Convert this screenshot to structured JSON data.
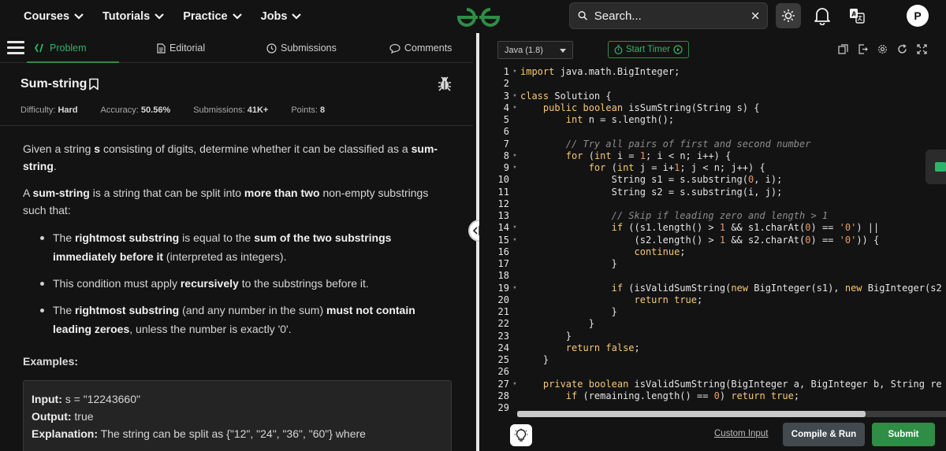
{
  "nav": {
    "items": [
      {
        "label": "Courses"
      },
      {
        "label": "Tutorials"
      },
      {
        "label": "Practice"
      },
      {
        "label": "Jobs"
      }
    ],
    "search_placeholder": "Search...",
    "avatar_letter": "P"
  },
  "tabs": [
    {
      "label": "Problem",
      "icon": "code-icon"
    },
    {
      "label": "Editorial",
      "icon": "document-icon"
    },
    {
      "label": "Submissions",
      "icon": "clock-icon"
    },
    {
      "label": "Comments",
      "icon": "chat-bubble-icon"
    }
  ],
  "problem": {
    "title": "Sum-string",
    "meta": [
      {
        "label": "Difficulty:",
        "value": "Hard"
      },
      {
        "label": "Accuracy:",
        "value": "50.56%"
      },
      {
        "label": "Submissions:",
        "value": "41K+"
      },
      {
        "label": "Points:",
        "value": "8"
      }
    ],
    "p1": {
      "a": "Given a string ",
      "b": "s",
      "c": " consisting of digits, determine whether it can be classified as a ",
      "d": "sum-string",
      "e": "."
    },
    "p2": {
      "a": "A ",
      "b": "sum-string",
      "c": " is a string that can be split into ",
      "d": "more than two",
      "e": " non-empty substrings such that:"
    },
    "bullet1": {
      "a": "The ",
      "b": "rightmost substring",
      "c": " is equal to the ",
      "d": "sum of the two substrings immediately before it",
      "e": " (interpreted as integers)."
    },
    "bullet2": {
      "a": "This condition must apply ",
      "b": "recursively",
      "c": " to the substrings before it."
    },
    "bullet3": {
      "a": "The ",
      "b": "rightmost substring",
      "c": " (and any number in the sum) ",
      "d": "must not contain leading zeroes",
      "e": ", unless the number is exactly '0'."
    },
    "examples_label": "Examples:",
    "example": {
      "input_label": "Input:",
      "input_value": "s = \"12243660\"",
      "output_label": "Output:",
      "output_value": "true",
      "explanation_label": "Explanation:",
      "explanation_value": "The string can be split as {\"12\", \"24\", \"36\", \"60\"} where"
    }
  },
  "editor": {
    "language": "Java (1.8)",
    "timer_label": "Start Timer",
    "custom_input_label": "Custom Input",
    "run_label": "Compile & Run",
    "submit_label": "Submit"
  },
  "code_lines": [
    {
      "n": "1",
      "f": "▾",
      "html": "<span class='kw'>import</span> java.math.BigInteger;"
    },
    {
      "n": "2",
      "f": "",
      "html": ""
    },
    {
      "n": "3",
      "f": "▾",
      "html": "<span class='kw'>class</span> Solution {"
    },
    {
      "n": "4",
      "f": "▾",
      "html": "    <span class='kw'>public</span> <span class='kw'>boolean</span> isSumString(String s) {"
    },
    {
      "n": "5",
      "f": "",
      "html": "        <span class='kw'>int</span> n = s.length();"
    },
    {
      "n": "6",
      "f": "",
      "html": ""
    },
    {
      "n": "7",
      "f": "",
      "html": "        <span class='cm'>// Try all pairs of first and second number</span>"
    },
    {
      "n": "8",
      "f": "▾",
      "html": "        <span class='kw'>for</span> (<span class='kw'>int</span> i = <span class='num'>1</span>; i &lt; n; i++) {"
    },
    {
      "n": "9",
      "f": "▾",
      "html": "            <span class='kw'>for</span> (<span class='kw'>int</span> j = i+<span class='num'>1</span>; j &lt; n; j++) {"
    },
    {
      "n": "10",
      "f": "",
      "html": "                String s1 = s.substring(<span class='num'>0</span>, i);"
    },
    {
      "n": "11",
      "f": "",
      "html": "                String s2 = s.substring(i, j);"
    },
    {
      "n": "12",
      "f": "",
      "html": ""
    },
    {
      "n": "13",
      "f": "",
      "html": "                <span class='cm'>// Skip if leading zero and length &gt; 1</span>"
    },
    {
      "n": "14",
      "f": "▾",
      "html": "                <span class='kw'>if</span> ((s1.length() &gt; <span class='num'>1</span> &amp;&amp; s1.charAt(<span class='num'>0</span>) == <span class='str'>'0'</span>) ||"
    },
    {
      "n": "15",
      "f": "▾",
      "html": "                    (s2.length() &gt; <span class='num'>1</span> &amp;&amp; s2.charAt(<span class='num'>0</span>) == <span class='str'>'0'</span>)) {"
    },
    {
      "n": "16",
      "f": "",
      "html": "                    <span class='kw'>continue</span>;"
    },
    {
      "n": "17",
      "f": "",
      "html": "                }"
    },
    {
      "n": "18",
      "f": "",
      "html": ""
    },
    {
      "n": "19",
      "f": "▾",
      "html": "                <span class='kw'>if</span> (isValidSumString(<span class='kw'>new</span> BigInteger(s1), <span class='kw'>new</span> BigInteger(s2"
    },
    {
      "n": "20",
      "f": "",
      "html": "                    <span class='kw'>return</span> <span class='kw'>true</span>;"
    },
    {
      "n": "21",
      "f": "",
      "html": "                }"
    },
    {
      "n": "22",
      "f": "",
      "html": "            }"
    },
    {
      "n": "23",
      "f": "",
      "html": "        }"
    },
    {
      "n": "24",
      "f": "",
      "html": "        <span class='kw'>return</span> <span class='kw'>false</span>;"
    },
    {
      "n": "25",
      "f": "",
      "html": "    }"
    },
    {
      "n": "26",
      "f": "",
      "html": ""
    },
    {
      "n": "27",
      "f": "▾",
      "html": "    <span class='kw'>private</span> <span class='kw'>boolean</span> isValidSumString(BigInteger a, BigInteger b, String re"
    },
    {
      "n": "28",
      "f": "",
      "html": "        <span class='kw'>if</span> (remaining.length() == <span class='num'>0</span>) <span class='kw'>return</span> <span class='kw'>true</span>;"
    },
    {
      "n": "29",
      "f": "",
      "html": ""
    }
  ]
}
